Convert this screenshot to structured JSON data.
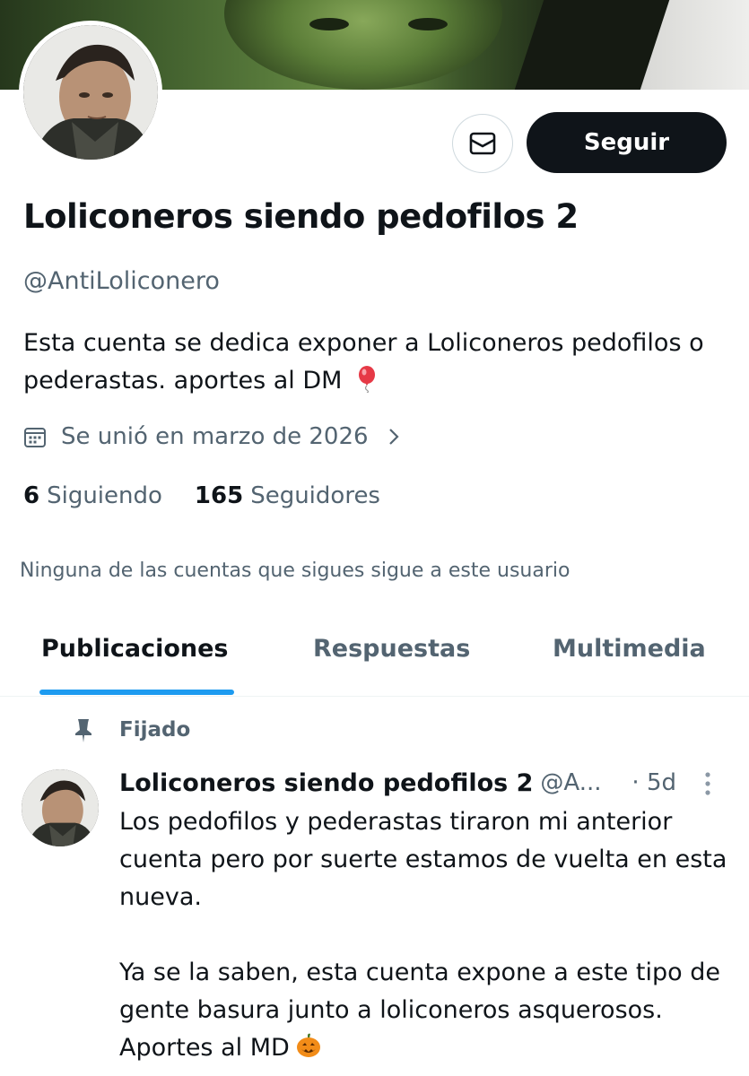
{
  "profile": {
    "display_name": "Loliconeros siendo pedofilos 2",
    "handle": "@AntiLoliconero",
    "bio": "Esta cuenta se dedica exponer a Loliconeros pedofilos o pederastas. aportes al DM",
    "joined": "Se unió en marzo de 2026",
    "following_count": "6",
    "following_label": "Siguiendo",
    "followers_count": "165",
    "followers_label": "Seguidores",
    "mutual_note": "Ninguna de las cuentas que sigues sigue a este usuario"
  },
  "actions": {
    "message_icon": "envelope-icon",
    "follow_label": "Seguir"
  },
  "tabs": [
    {
      "label": "Publicaciones",
      "active": true
    },
    {
      "label": "Respuestas",
      "active": false
    },
    {
      "label": "Multimedia",
      "active": false
    }
  ],
  "pinned_post": {
    "pinned_label": "Fijado",
    "author_name": "Loliconeros siendo pedofilos 2",
    "author_handle": "@A...",
    "time": "· 5d",
    "paragraph_1": "Los pedofilos y pederastas tiraron mi anterior cuenta pero por suerte estamos de vuelta en esta nueva.",
    "paragraph_2": "Ya se la saben, esta cuenta expone a este tipo de gente basura junto a loliconeros asquerosos. Aportes al MD"
  },
  "colors": {
    "accent": "#1d9bf0",
    "text_primary": "#0f1419",
    "text_secondary": "#536471",
    "button_dark": "#0f1419"
  }
}
